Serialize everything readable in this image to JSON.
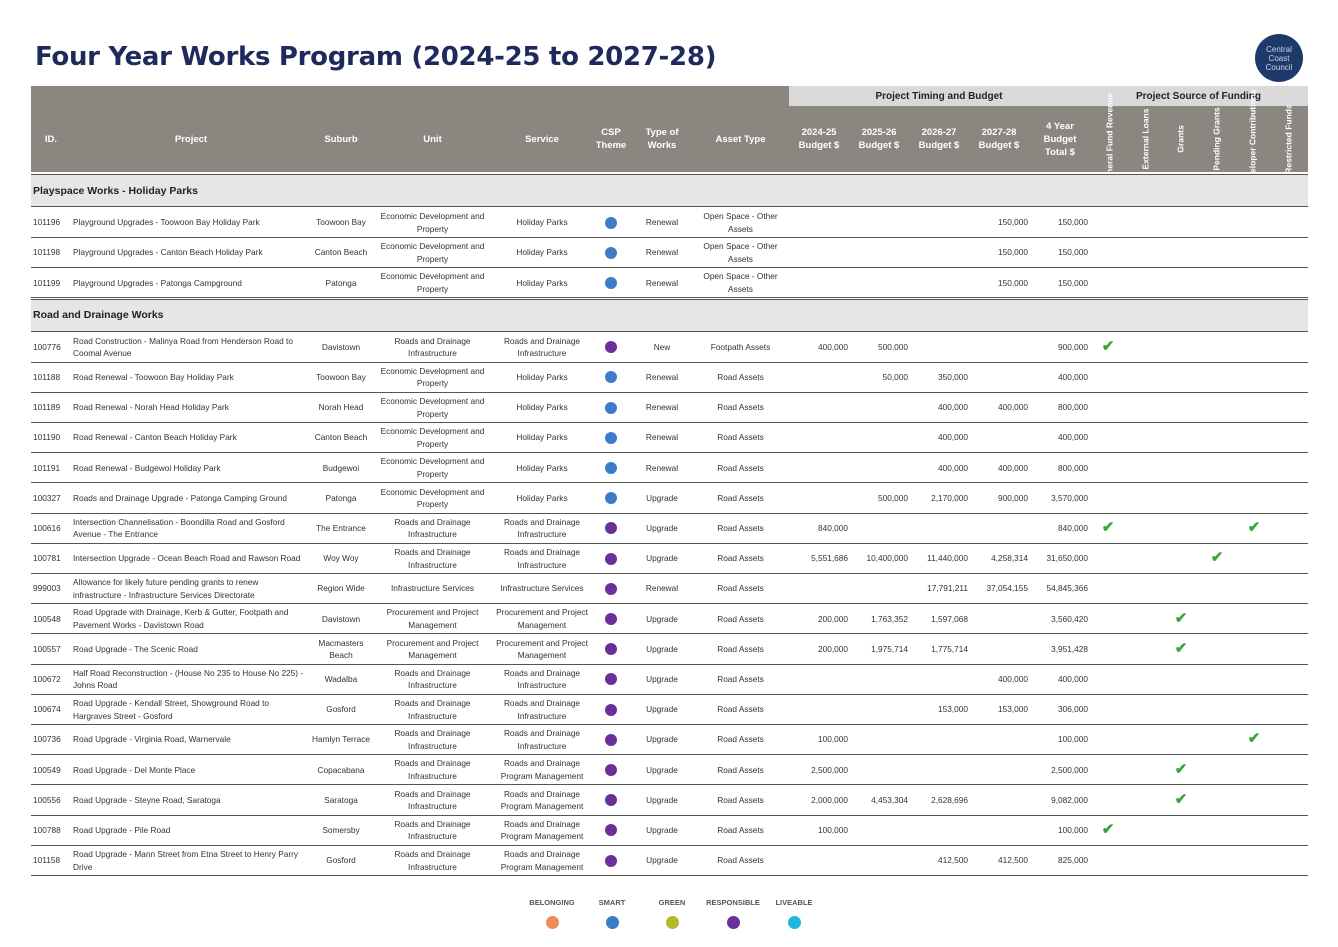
{
  "title": "Four Year Works Program (2024-25 to 2027-28)",
  "logo": {
    "line1": "Central",
    "line2": "Coast",
    "line3": "Council"
  },
  "group_headers": {
    "timing": "Project Timing and Budget",
    "funding": "Project Source of Funding"
  },
  "columns": {
    "id": "ID.",
    "project": "Project",
    "suburb": "Suburb",
    "unit": "Unit",
    "service": "Service",
    "csp": "CSP Theme",
    "type": "Type of Works",
    "asset": "Asset Type",
    "y1": "2024-25 Budget $",
    "y2": "2025-26 Budget $",
    "y3": "2026-27 Budget $",
    "y4": "2027-28 Budget $",
    "total": "4 Year Budget Total $",
    "f1": "General Fund Revenue",
    "f2": "External Loans",
    "f3": "Grants",
    "f4": "Pending Grants",
    "f5": "Developer Contributions",
    "f6": "Restricted Funds"
  },
  "theme_colors": {
    "BELONGING": "#f08a5d",
    "SMART": "#3d7cc9",
    "GREEN": "#b5b82a",
    "RESPONSIBLE": "#6b2f9a",
    "LIVEABLE": "#1fb8d8"
  },
  "sections": [
    {
      "name": "Playspace Works - Holiday Parks",
      "rows": [
        {
          "id": "101196",
          "project": "Playground Upgrades - Toowoon Bay Holiday Park",
          "suburb": "Toowoon Bay",
          "unit": "Economic Development and Property",
          "service": "Holiday Parks",
          "theme": "SMART",
          "type": "Renewal",
          "asset": "Open Space - Other Assets",
          "y1": "",
          "y2": "",
          "y3": "",
          "y4": "150,000",
          "total": "150,000",
          "funding": []
        },
        {
          "id": "101198",
          "project": "Playground Upgrades - Canton Beach Holiday Park",
          "suburb": "Canton Beach",
          "unit": "Economic Development and Property",
          "service": "Holiday Parks",
          "theme": "SMART",
          "type": "Renewal",
          "asset": "Open Space - Other Assets",
          "y1": "",
          "y2": "",
          "y3": "",
          "y4": "150,000",
          "total": "150,000",
          "funding": []
        },
        {
          "id": "101199",
          "project": "Playground Upgrades - Patonga Campground",
          "suburb": "Patonga",
          "unit": "Economic Development and Property",
          "service": "Holiday Parks",
          "theme": "SMART",
          "type": "Renewal",
          "asset": "Open Space - Other Assets",
          "y1": "",
          "y2": "",
          "y3": "",
          "y4": "150,000",
          "total": "150,000",
          "funding": []
        }
      ]
    },
    {
      "name": "Road and Drainage Works",
      "rows": [
        {
          "id": "100776",
          "project": "Road Construction - Malinya Road from Henderson Road to Coomal Avenue",
          "suburb": "Davistown",
          "unit": "Roads and Drainage Infrastructure",
          "service": "Roads and Drainage Infrastructure",
          "theme": "RESPONSIBLE",
          "type": "New",
          "asset": "Footpath Assets",
          "y1": "400,000",
          "y2": "500,000",
          "y3": "",
          "y4": "",
          "total": "900,000",
          "funding": [
            1
          ]
        },
        {
          "id": "101188",
          "project": "Road Renewal - Toowoon Bay Holiday Park",
          "suburb": "Toowoon Bay",
          "unit": "Economic Development and Property",
          "service": "Holiday Parks",
          "theme": "SMART",
          "type": "Renewal",
          "asset": "Road Assets",
          "y1": "",
          "y2": "50,000",
          "y3": "350,000",
          "y4": "",
          "total": "400,000",
          "funding": []
        },
        {
          "id": "101189",
          "project": "Road Renewal - Norah Head Holiday Park",
          "suburb": "Norah Head",
          "unit": "Economic Development and Property",
          "service": "Holiday Parks",
          "theme": "SMART",
          "type": "Renewal",
          "asset": "Road Assets",
          "y1": "",
          "y2": "",
          "y3": "400,000",
          "y4": "400,000",
          "total": "800,000",
          "funding": []
        },
        {
          "id": "101190",
          "project": "Road Renewal - Canton Beach Holiday Park",
          "suburb": "Canton Beach",
          "unit": "Economic Development and Property",
          "service": "Holiday Parks",
          "theme": "SMART",
          "type": "Renewal",
          "asset": "Road Assets",
          "y1": "",
          "y2": "",
          "y3": "400,000",
          "y4": "",
          "total": "400,000",
          "funding": []
        },
        {
          "id": "101191",
          "project": "Road Renewal - Budgewoi Holiday Park",
          "suburb": "Budgewoi",
          "unit": "Economic Development and Property",
          "service": "Holiday Parks",
          "theme": "SMART",
          "type": "Renewal",
          "asset": "Road Assets",
          "y1": "",
          "y2": "",
          "y3": "400,000",
          "y4": "400,000",
          "total": "800,000",
          "funding": []
        },
        {
          "id": "100327",
          "project": "Roads and Drainage Upgrade - Patonga Camping Ground",
          "suburb": "Patonga",
          "unit": "Economic Development and Property",
          "service": "Holiday Parks",
          "theme": "SMART",
          "type": "Upgrade",
          "asset": "Road Assets",
          "y1": "",
          "y2": "500,000",
          "y3": "2,170,000",
          "y4": "900,000",
          "total": "3,570,000",
          "funding": []
        },
        {
          "id": "100616",
          "project": "Intersection Channelisation - Boondilla Road and Gosford Avenue - The Entrance",
          "suburb": "The Entrance",
          "unit": "Roads and Drainage Infrastructure",
          "service": "Roads and Drainage Infrastructure",
          "theme": "RESPONSIBLE",
          "type": "Upgrade",
          "asset": "Road Assets",
          "y1": "840,000",
          "y2": "",
          "y3": "",
          "y4": "",
          "total": "840,000",
          "funding": [
            1,
            5
          ]
        },
        {
          "id": "100781",
          "project": "Intersection Upgrade - Ocean Beach Road and Rawson Road",
          "suburb": "Woy Woy",
          "unit": "Roads and Drainage Infrastructure",
          "service": "Roads and Drainage Infrastructure",
          "theme": "RESPONSIBLE",
          "type": "Upgrade",
          "asset": "Road Assets",
          "y1": "5,551,686",
          "y2": "10,400,000",
          "y3": "11,440,000",
          "y4": "4,258,314",
          "total": "31,650,000",
          "funding": [
            4
          ]
        },
        {
          "id": "999003",
          "project": "Allowance for likely future pending grants to renew infrastructure - Infrastructure Services Directorate",
          "suburb": "Region Wide",
          "unit": "Infrastructure Services",
          "service": "Infrastructure Services",
          "theme": "RESPONSIBLE",
          "type": "Renewal",
          "asset": "Road Assets",
          "y1": "",
          "y2": "",
          "y3": "17,791,211",
          "y4": "37,054,155",
          "total": "54,845,366",
          "funding": []
        },
        {
          "id": "100548",
          "project": "Road Upgrade with Drainage, Kerb & Gutter, Footpath and Pavement Works - Davistown Road",
          "suburb": "Davistown",
          "unit": "Procurement and Project Management",
          "service": "Procurement and Project Management",
          "theme": "RESPONSIBLE",
          "type": "Upgrade",
          "asset": "Road Assets",
          "y1": "200,000",
          "y2": "1,763,352",
          "y3": "1,597,068",
          "y4": "",
          "total": "3,560,420",
          "funding": [
            3
          ]
        },
        {
          "id": "100557",
          "project": "Road Upgrade - The Scenic Road",
          "suburb": "Macmasters Beach",
          "unit": "Procurement and Project Management",
          "service": "Procurement and Project Management",
          "theme": "RESPONSIBLE",
          "type": "Upgrade",
          "asset": "Road Assets",
          "y1": "200,000",
          "y2": "1,975,714",
          "y3": "1,775,714",
          "y4": "",
          "total": "3,951,428",
          "funding": [
            3
          ]
        },
        {
          "id": "100672",
          "project": "Half Road Reconstruction - (House No 235 to House No 225) - Johns Road",
          "suburb": "Wadalba",
          "unit": "Roads and Drainage Infrastructure",
          "service": "Roads and Drainage Infrastructure",
          "theme": "RESPONSIBLE",
          "type": "Upgrade",
          "asset": "Road Assets",
          "y1": "",
          "y2": "",
          "y3": "",
          "y4": "400,000",
          "total": "400,000",
          "funding": []
        },
        {
          "id": "100674",
          "project": "Road Upgrade - Kendall Street, Showground Road to Hargraves Street - Gosford",
          "suburb": "Gosford",
          "unit": "Roads and Drainage Infrastructure",
          "service": "Roads and Drainage Infrastructure",
          "theme": "RESPONSIBLE",
          "type": "Upgrade",
          "asset": "Road Assets",
          "y1": "",
          "y2": "",
          "y3": "153,000",
          "y4": "153,000",
          "total": "306,000",
          "funding": []
        },
        {
          "id": "100736",
          "project": "Road Upgrade - Virginia Road, Warnervale",
          "suburb": "Hamlyn Terrace",
          "unit": "Roads and Drainage Infrastructure",
          "service": "Roads and Drainage Infrastructure",
          "theme": "RESPONSIBLE",
          "type": "Upgrade",
          "asset": "Road Assets",
          "y1": "100,000",
          "y2": "",
          "y3": "",
          "y4": "",
          "total": "100,000",
          "funding": [
            5
          ]
        },
        {
          "id": "100549",
          "project": "Road Upgrade - Del Monte Place",
          "suburb": "Copacabana",
          "unit": "Roads and Drainage Infrastructure",
          "service": "Roads and Drainage Program Management",
          "theme": "RESPONSIBLE",
          "type": "Upgrade",
          "asset": "Road Assets",
          "y1": "2,500,000",
          "y2": "",
          "y3": "",
          "y4": "",
          "total": "2,500,000",
          "funding": [
            3
          ]
        },
        {
          "id": "100556",
          "project": "Road Upgrade - Steyne Road, Saratoga",
          "suburb": "Saratoga",
          "unit": "Roads and Drainage Infrastructure",
          "service": "Roads and Drainage Program Management",
          "theme": "RESPONSIBLE",
          "type": "Upgrade",
          "asset": "Road Assets",
          "y1": "2,000,000",
          "y2": "4,453,304",
          "y3": "2,628,696",
          "y4": "",
          "total": "9,082,000",
          "funding": [
            3
          ]
        },
        {
          "id": "100788",
          "project": "Road Upgrade - Pile Road",
          "suburb": "Somersby",
          "unit": "Roads and Drainage Infrastructure",
          "service": "Roads and Drainage Program Management",
          "theme": "RESPONSIBLE",
          "type": "Upgrade",
          "asset": "Road Assets",
          "y1": "100,000",
          "y2": "",
          "y3": "",
          "y4": "",
          "total": "100,000",
          "funding": [
            1
          ]
        },
        {
          "id": "101158",
          "project": "Road Upgrade - Mann Street from Etna Street to Henry Parry Drive",
          "suburb": "Gosford",
          "unit": "Roads and Drainage Infrastructure",
          "service": "Roads and Drainage Program Management",
          "theme": "RESPONSIBLE",
          "type": "Upgrade",
          "asset": "Road Assets",
          "y1": "",
          "y2": "",
          "y3": "412,500",
          "y4": "412,500",
          "total": "825,000",
          "funding": []
        }
      ]
    }
  ],
  "legend": [
    "BELONGING",
    "SMART",
    "GREEN",
    "RESPONSIBLE",
    "LIVEABLE"
  ],
  "tick_symbol": "✔"
}
